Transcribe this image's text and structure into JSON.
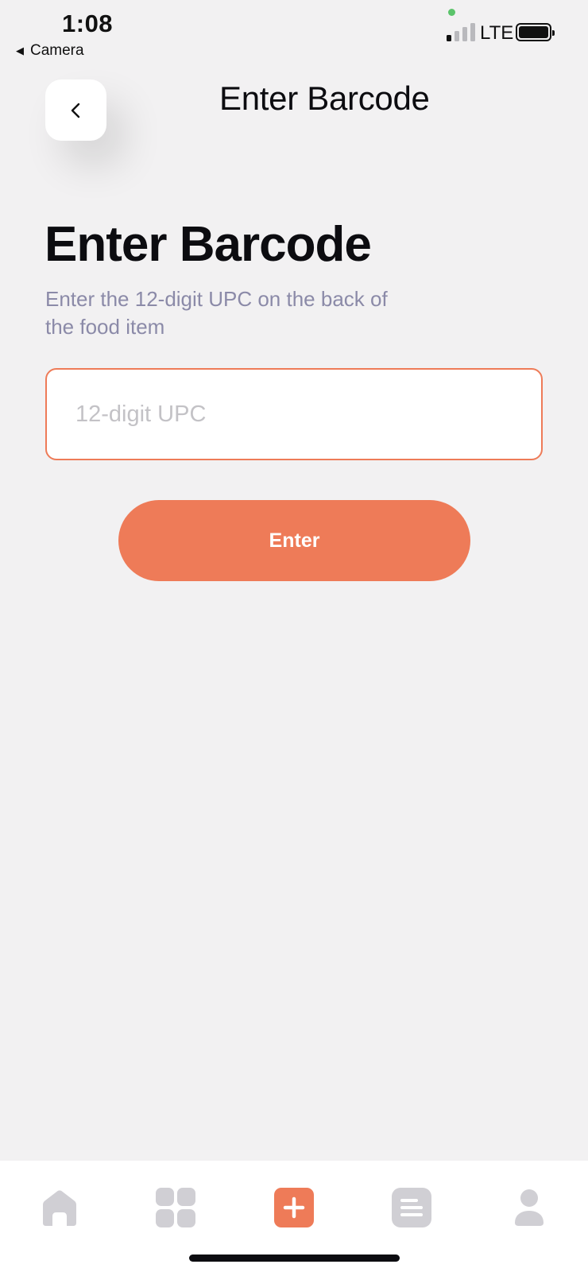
{
  "status_bar": {
    "time": "1:08",
    "back_app": "Camera",
    "network": "LTE"
  },
  "header": {
    "title": "Enter Barcode"
  },
  "main": {
    "title": "Enter Barcode",
    "subtitle": "Enter the 12-digit UPC on the back of the food item",
    "upc_input": {
      "value": "",
      "placeholder": "12-digit UPC"
    },
    "enter_label": "Enter"
  },
  "tab_bar": {
    "items": [
      {
        "icon": "home-icon",
        "active": false
      },
      {
        "icon": "grid-icon",
        "active": false
      },
      {
        "icon": "add-icon",
        "active": true
      },
      {
        "icon": "list-icon",
        "active": false
      },
      {
        "icon": "profile-icon",
        "active": false
      }
    ]
  },
  "colors": {
    "accent": "#ee7b58",
    "background": "#f2f1f2",
    "subtitle": "#8b8aa8",
    "inactive_icon": "#d0cfd4"
  }
}
